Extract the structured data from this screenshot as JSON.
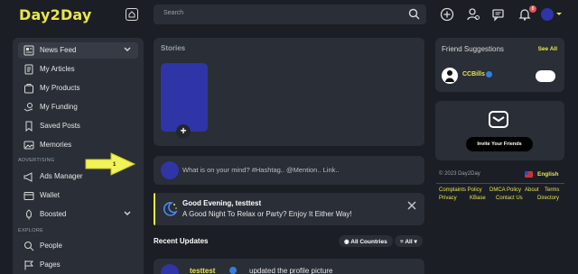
{
  "app": {
    "logo": "Day2Day"
  },
  "search": {
    "placeholder": "Search"
  },
  "notifications": {
    "count": "8"
  },
  "sidebar": {
    "items": [
      {
        "label": "News Feed",
        "icon": "newspaper-icon",
        "active": true
      },
      {
        "label": "My Articles",
        "icon": "article-icon"
      },
      {
        "label": "My Products",
        "icon": "product-box-icon"
      },
      {
        "label": "My Funding",
        "icon": "funding-icon"
      },
      {
        "label": "Saved Posts",
        "icon": "bookmark-icon"
      },
      {
        "label": "Memories",
        "icon": "memories-icon"
      }
    ],
    "sections": {
      "advertising": "ADVERTISING",
      "explore": "EXPLORE"
    },
    "advertising_items": [
      {
        "label": "Ads Manager",
        "icon": "megaphone-icon"
      },
      {
        "label": "Wallet",
        "icon": "wallet-icon"
      },
      {
        "label": "Boosted",
        "icon": "rocket-icon"
      }
    ],
    "explore_items": [
      {
        "label": "People",
        "icon": "people-search-icon"
      },
      {
        "label": "Pages",
        "icon": "flag-icon"
      }
    ]
  },
  "stories": {
    "title": "Stories",
    "add_label": "+"
  },
  "composer": {
    "placeholder": "What is on your mind? #Hashtag.. @Mention.. Link.."
  },
  "greeting": {
    "title": "Good Evening, testtest",
    "subtitle": "A Good Night To Relax or Party? Enjoy It Either Way!"
  },
  "recent": {
    "title": "Recent Updates",
    "filter_all_countries": "All Countries",
    "filter_all": "All"
  },
  "post": {
    "author": "testtest",
    "action": "updated the profile picture"
  },
  "friend_suggestions": {
    "title": "Friend Suggestions",
    "see_all": "See All",
    "items": [
      {
        "name": "CCBills"
      }
    ]
  },
  "invite": {
    "button": "Invite Your Friends"
  },
  "footer": {
    "copyright": "© 2023 Day2Day",
    "language": "English",
    "links": [
      "Complaints Policy",
      "DMCA Policy",
      "About",
      "Terms",
      "Privacy",
      "KBase",
      "Contact Us",
      "Directory"
    ]
  },
  "annotation": {
    "arrow_number": "1"
  },
  "colors": {
    "accent": "#e8e64a",
    "panel": "#2a2e36",
    "background": "#1b1e24",
    "avatar": "#2f35a6"
  }
}
